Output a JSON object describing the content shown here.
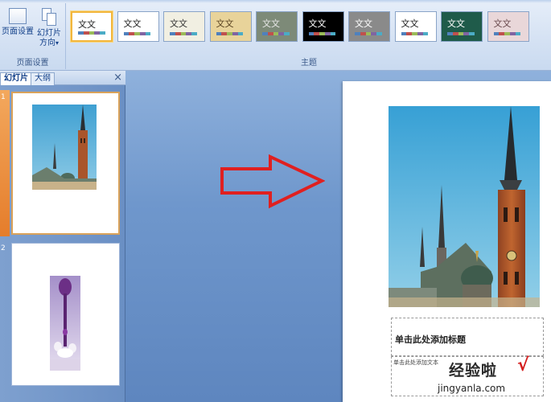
{
  "ribbon": {
    "page_group": {
      "setup_label": "页面设置",
      "orientation_label_line1": "幻灯片",
      "orientation_label_line2": "方向",
      "orientation_dropdown": "▾",
      "group_label": "页面设置"
    },
    "themes_group": {
      "group_label": "主题",
      "sample_text": "文文",
      "themes": [
        {
          "bg": "#ffffff",
          "fg": "#222222",
          "selected": true
        },
        {
          "bg": "#ffffff",
          "fg": "#222222",
          "selected": false
        },
        {
          "bg": "#f1efe2",
          "fg": "#333333",
          "selected": false
        },
        {
          "bg": "#e8d39a",
          "fg": "#5a4422",
          "selected": false
        },
        {
          "bg": "#7d8a78",
          "fg": "#e8e8e8",
          "selected": false
        },
        {
          "bg": "#000000",
          "fg": "#ffffff",
          "selected": false
        },
        {
          "bg": "#8a8a8a",
          "fg": "#ffffff",
          "selected": false
        },
        {
          "bg": "#ffffff",
          "fg": "#222222",
          "selected": false
        },
        {
          "bg": "#1f5b4a",
          "fg": "#ffffff",
          "selected": false
        },
        {
          "bg": "#e9d7d9",
          "fg": "#6a4a4e",
          "selected": false
        }
      ]
    }
  },
  "panel": {
    "tab_slides": "幻灯片",
    "tab_outline": "大纲",
    "close": "×",
    "slides": [
      {
        "number": "1",
        "picture": "church-tower-photo"
      },
      {
        "number": "2",
        "picture": "purple-vase-photo"
      }
    ]
  },
  "slide": {
    "title_placeholder": "单击此处添加标题",
    "body_placeholder": "单击此处添加文本",
    "arrow_color": "#e02020"
  },
  "watermark": {
    "main": "经验啦",
    "check": "√",
    "url": "jingyanla.com"
  }
}
